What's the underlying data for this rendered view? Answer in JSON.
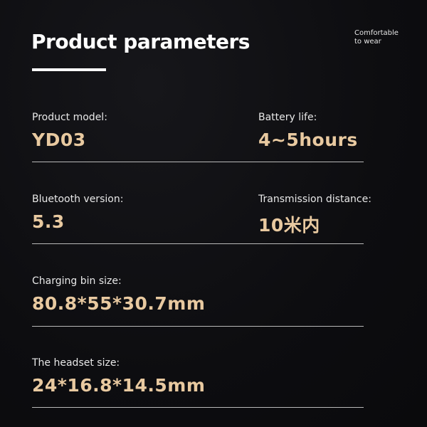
{
  "header": {
    "title": "Product parameters",
    "tagline": "Comfortable\nto wear"
  },
  "specs": {
    "product_model": {
      "label": "Product model:",
      "value": "YD03"
    },
    "battery_life": {
      "label": "Battery life:",
      "value": "4~5hours"
    },
    "bluetooth_version": {
      "label": "Bluetooth version:",
      "value": "5.3"
    },
    "transmission_distance": {
      "label": "Transmission distance:",
      "value": "10米内"
    },
    "charging_bin_size": {
      "label": "Charging bin size:",
      "value": "80.8*55*30.7mm"
    },
    "headset_size": {
      "label": "The headset size:",
      "value": "24*16.8*14.5mm"
    }
  },
  "colors": {
    "background": "#0e0e11",
    "value_accent": "#e8c9a0",
    "text": "#e8e8e8"
  }
}
